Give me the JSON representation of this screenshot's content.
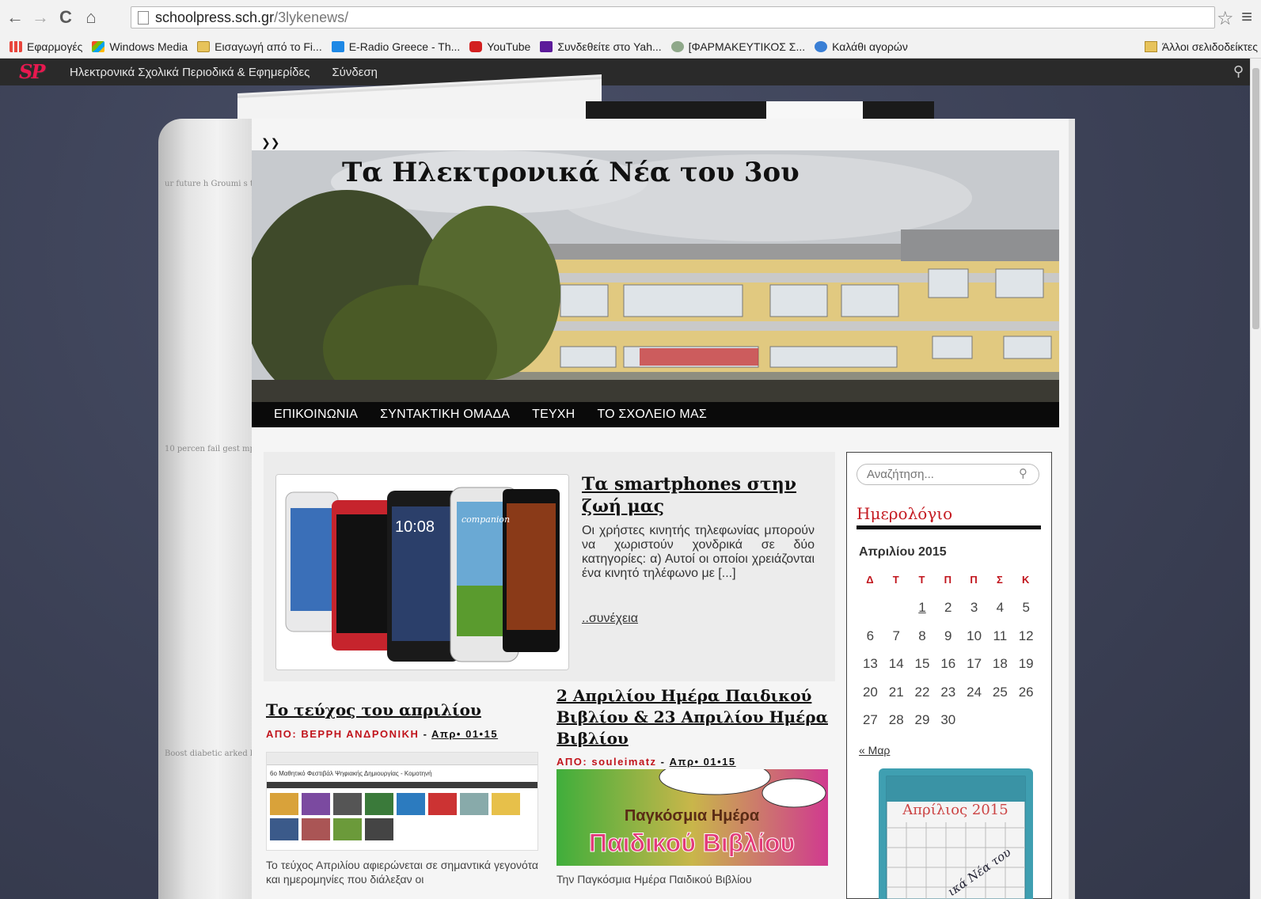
{
  "browser": {
    "url_host": "schoolpress.sch.gr",
    "url_path": "/3lykenews/",
    "bookmarks": [
      {
        "label": "Εφαρμογές",
        "icon": "apps-icon"
      },
      {
        "label": "Windows Media",
        "icon": "windows-media-icon"
      },
      {
        "label": "Εισαγωγή από το Fi...",
        "icon": "folder-icon"
      },
      {
        "label": "E-Radio Greece - Th...",
        "icon": "eradio-icon"
      },
      {
        "label": "YouTube",
        "icon": "youtube-icon"
      },
      {
        "label": "Συνδεθείτε στο Yah...",
        "icon": "yahoo-icon"
      },
      {
        "label": "[ΦΑΡΜΑΚΕΥΤΙΚΟΣ Σ...",
        "icon": "pharmacy-icon"
      },
      {
        "label": "Καλάθι αγορών",
        "icon": "cart-icon"
      }
    ],
    "other_bookmarks": "Άλλοι σελιδοδείκτες"
  },
  "adminbar": {
    "logo": "SP",
    "site_link": "Ηλεκτρονικά Σχολικά Περιοδικά & Εφημερίδες",
    "login": "Σύνδεση"
  },
  "site": {
    "title": "Τα Ηλεκτρονικά Νέα του 3ου",
    "nav": [
      "ΕΠΙΚΟΙΝΩΝΙΑ",
      "ΣΥΝΤΑΚΤΙΚΗ ΟΜΑΔΑ",
      "ΤΕΥΧΗ",
      "ΤΟ ΣΧΟΛΕΙΟ ΜΑΣ"
    ]
  },
  "featured": {
    "title": "Τα smartphones στην ζωή μας",
    "excerpt": "Οι χρήστες κινητής τηλεφωνίας μπορούν να χωριστούν χονδρικά σε δύο κατηγορίες: α) Αυτοί οι οποίοι χρειάζονται ένα κινητό τηλέφωνο με [...]",
    "more": "..συνέχεια",
    "phone_time": "10:08",
    "phone_brand": "companion"
  },
  "posts": [
    {
      "title": "Το τεύχος του απριλίου",
      "by_label": "ΑΠΟ:",
      "author": "ΒΕΡΡΗ ΑΝΔΡΟΝΙΚΗ",
      "date": "Απρ• 01•15",
      "thumb_caption": "6ο Μαθητικό Φεστιβάλ Ψηφιακής Δημιουργίας - Κομοτηνή",
      "excerpt": "Το τεύχος Απριλίου αφιερώνεται σε σημαντικά γεγονότα και ημερομηνίες που διάλεξαν οι"
    },
    {
      "title": "2 Απριλίου Ημέρα Παιδικού Βιβλίου & 23 Απριλίου Ημέρα Βιβλίου",
      "by_label": "ΑΠΟ:",
      "author": "souleimatz",
      "date": "Απρ• 01•15",
      "image_line1": "Παγκόσμια Ημέρα",
      "image_line2": "Παιδικού Βιβλίου",
      "excerpt": "Την Παγκόσμια Ημέρα Παιδικού Βιβλίου"
    }
  ],
  "sidebar": {
    "search_placeholder": "Αναζήτηση...",
    "calendar_heading": "Ημερολόγιο",
    "calendar_caption": "Απριλίου 2015",
    "weekdays": [
      "Δ",
      "Τ",
      "Τ",
      "Π",
      "Π",
      "Σ",
      "Κ"
    ],
    "weeks": [
      [
        "",
        "",
        "1",
        "2",
        "3",
        "4",
        "5"
      ],
      [
        "6",
        "7",
        "8",
        "9",
        "10",
        "11",
        "12"
      ],
      [
        "13",
        "14",
        "15",
        "16",
        "17",
        "18",
        "19"
      ],
      [
        "20",
        "21",
        "22",
        "23",
        "24",
        "25",
        "26"
      ],
      [
        "27",
        "28",
        "29",
        "30",
        "",
        "",
        ""
      ]
    ],
    "linked_day": "1",
    "prev_month": "« Μαρ",
    "widget_title": "Απρίλιος 2015",
    "widget_stamp": "ικά Νέα του"
  },
  "colors": {
    "accent_red": "#c1141c",
    "nav_bg": "#0a0a0a",
    "page_bg": "#3c4156",
    "adminbar_bg": "#2a2a2a"
  }
}
